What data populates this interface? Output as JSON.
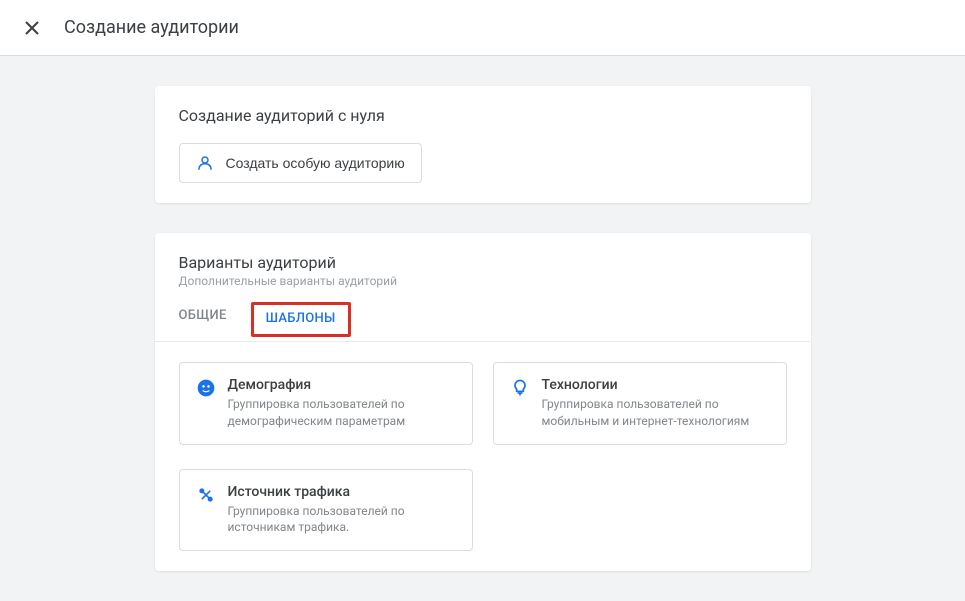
{
  "header": {
    "title": "Создание аудитории"
  },
  "scratch_section": {
    "title": "Создание аудиторий с нуля",
    "create_button": "Создать особую аудиторию"
  },
  "variants_section": {
    "title": "Варианты аудиторий",
    "subtitle": "Дополнительные варианты аудиторий",
    "tabs": {
      "general": "ОБЩИЕ",
      "templates": "ШАБЛОНЫ"
    },
    "cards": {
      "demographics": {
        "title": "Демография",
        "desc": "Группировка пользователей по демографическим параметрам"
      },
      "technology": {
        "title": "Технологии",
        "desc": "Группировка пользователей по мобильным и интернет-технологиям"
      },
      "traffic": {
        "title": "Источник трафика",
        "desc": "Группировка пользователей по источникам трафика."
      }
    }
  }
}
